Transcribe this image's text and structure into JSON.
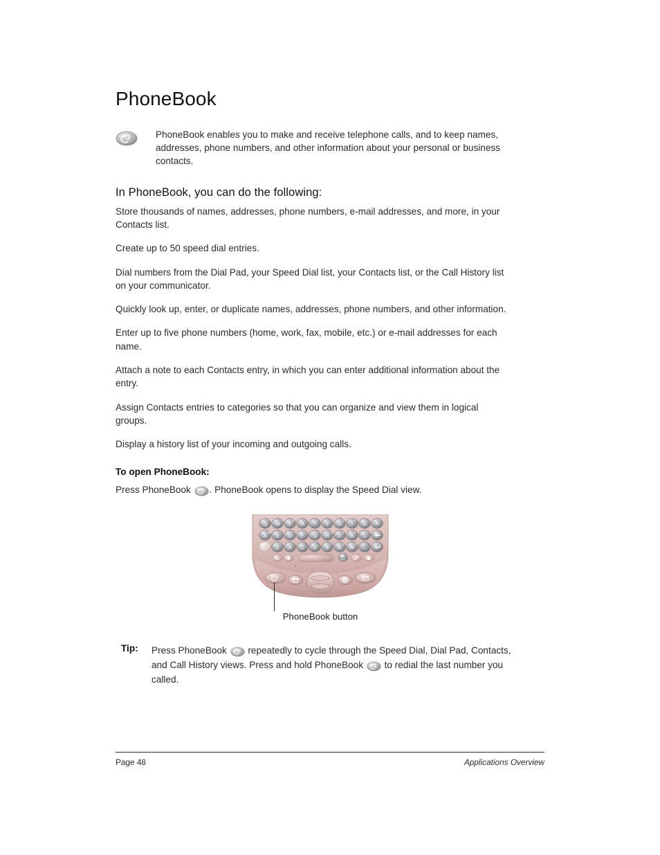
{
  "document": {
    "title": "PhoneBook",
    "intro": "PhoneBook enables you to make and receive telephone calls, and to keep names, addresses, phone numbers, and other information about your personal or business contacts.",
    "intro_icon": "phonebook-button-icon"
  },
  "features": {
    "heading": "In PhoneBook, you can do the following:",
    "items": [
      "Store thousands of names, addresses, phone numbers, e-mail addresses, and more, in your Contacts list.",
      "Create up to 50 speed dial entries.",
      "Dial numbers from the Dial Pad, your Speed Dial list, your Contacts list, or the Call History list on your communicator.",
      "Quickly look up, enter, or duplicate names, addresses, phone numbers, and other information.",
      "Enter up to five phone numbers (home, work, fax, mobile, etc.) or e-mail addresses for each name.",
      "Attach a note to each Contacts entry, in which you can enter additional information about the entry.",
      "Assign Contacts entries to categories so that you can organize and view them in logical groups.",
      "Display a history list of your incoming and outgoing calls."
    ]
  },
  "open_section": {
    "heading": "To open PhoneBook:",
    "text_before_icon": "Press PhoneBook",
    "text_after_icon": ". PhoneBook opens to display the Speed Dial view."
  },
  "figure": {
    "caption": "PhoneBook button",
    "device": {
      "body_color": "#d9bdba",
      "key_color": "#9a9a9e",
      "rows": [
        [
          "Q",
          "W",
          "E",
          "R",
          "T",
          "Y",
          "U",
          "I",
          "O",
          "P"
        ],
        [
          "A",
          "S",
          "D",
          "F",
          "G",
          "H",
          "J",
          "K",
          "L",
          "back"
        ],
        [
          "shift",
          "Z",
          "X",
          "C",
          "V",
          "B",
          "N",
          "M",
          ",",
          "enter"
        ],
        [
          "opt",
          "cap",
          "space",
          "0",
          "alt",
          "home"
        ]
      ],
      "superscripts_row1": [
        "´",
        "~",
        "$",
        "/",
        "*",
        "'",
        "2",
        "3",
        "-",
        "\""
      ],
      "superscripts_row2": [
        "@",
        "!",
        "+",
        "=",
        "#",
        ":",
        ";",
        "(",
        ")",
        ""
      ],
      "superscripts_row3": [
        "",
        "?",
        "",
        "",
        "",
        "7",
        "8",
        "9",
        "",
        ""
      ],
      "app_buttons": [
        "phone-button",
        "calendar-button",
        "five-way-navigator",
        "web-button",
        "messaging-button"
      ]
    }
  },
  "tip": {
    "label": "Tip:",
    "part1": "Press PhoneBook",
    "part2": "repeatedly to cycle through the Speed Dial, Dial Pad, Contacts, and Call History views. Press and hold PhoneBook",
    "part3": "to redial the last number you called."
  },
  "footer": {
    "page": "Page 48",
    "section": "Applications Overview"
  }
}
